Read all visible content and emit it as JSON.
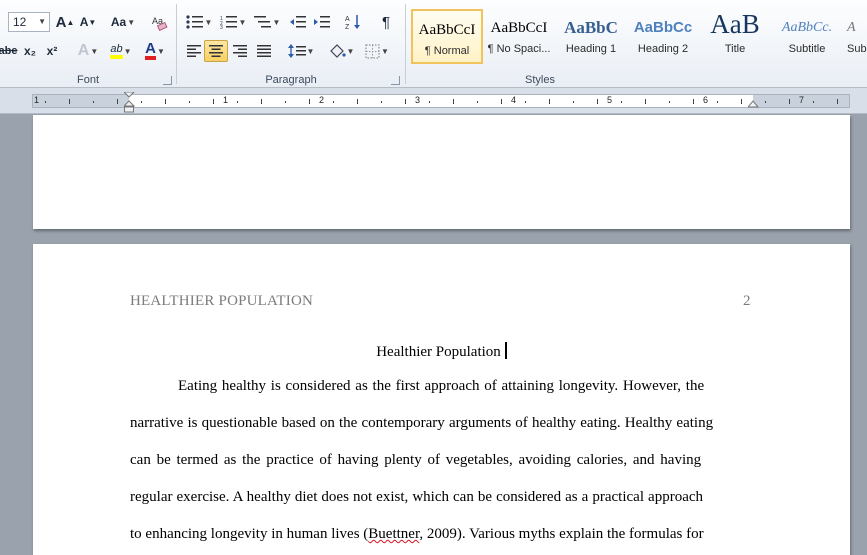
{
  "ribbon": {
    "font": {
      "size_value": "12",
      "strike_label": "abe",
      "subscript_label": "x₂",
      "superscript_label": "x²",
      "grow_label": "A",
      "shrink_label": "A",
      "case_label": "Aa",
      "highlight_label": "ab",
      "fontcolor_label": "A",
      "group_label": "Font"
    },
    "paragraph": {
      "group_label": "Paragraph"
    },
    "styles": {
      "group_label": "Styles",
      "items": [
        {
          "sample": "AaBbCcI",
          "name": "¶ Normal"
        },
        {
          "sample": "AaBbCcI",
          "name": "¶ No Spaci..."
        },
        {
          "sample": "AaBbC",
          "name": "Heading 1"
        },
        {
          "sample": "AaBbCc",
          "name": "Heading 2"
        },
        {
          "sample": "AaB",
          "name": "Title"
        },
        {
          "sample": "AaBbCc.",
          "name": "Subtitle"
        },
        {
          "sample": "A",
          "name": "Sub"
        }
      ]
    }
  },
  "ruler": {
    "numbers": [
      "1",
      "1",
      "2",
      "3",
      "4",
      "5",
      "6",
      "7"
    ]
  },
  "document": {
    "header_text": "HEALTHIER POPULATION",
    "page_number": "2",
    "title": "Healthier Population",
    "lines": [
      "Eating healthy is considered as the first approach of attaining longevity. However, the",
      "narrative is questionable based on the contemporary arguments of healthy eating. Healthy eating",
      "can be termed as the practice of having plenty of vegetables, avoiding calories, and having",
      "regular exercise. A healthy diet does not exist, which can be considered as a practical approach",
      "to enhancing longevity in human lives (",
      "Buettner",
      ", 2009). Various myths explain the formulas for"
    ]
  }
}
